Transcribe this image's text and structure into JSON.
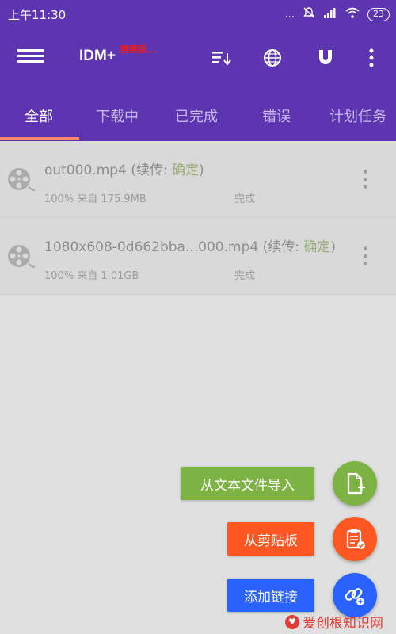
{
  "status_bar": {
    "time": "上午11:30",
    "dots": "...",
    "battery": "23"
  },
  "app_bar": {
    "title": "IDM+",
    "badge": "赛赛蔬..."
  },
  "tabs": [
    {
      "label": "全部",
      "active": true
    },
    {
      "label": "下载中",
      "active": false
    },
    {
      "label": "已完成",
      "active": false
    },
    {
      "label": "错误",
      "active": false
    },
    {
      "label": "计划任务",
      "active": false
    }
  ],
  "downloads": [
    {
      "filename": "out000.mp4",
      "resume_prefix": " (续传: ",
      "resume_value": "确定",
      "resume_suffix": ")",
      "progress": "100% 来自 175.9MB",
      "status": "完成"
    },
    {
      "filename": "1080x608-0d662bba...000.mp4",
      "resume_prefix": " (续传: ",
      "resume_value": "确定",
      "resume_suffix": ")",
      "progress": "100% 来自 1.01GB",
      "status": "完成"
    }
  ],
  "fab_menu": {
    "import_text": "从文本文件导入",
    "from_clipboard": "从剪贴板",
    "add_link": "添加链接"
  },
  "colors": {
    "primary": "#5e35b1",
    "tab_indicator": "#ff8a65",
    "import_green": "#7cb342",
    "clipboard_orange": "#ff5722",
    "link_blue": "#2962ff"
  },
  "watermark": {
    "text": "爱创根知识网"
  }
}
